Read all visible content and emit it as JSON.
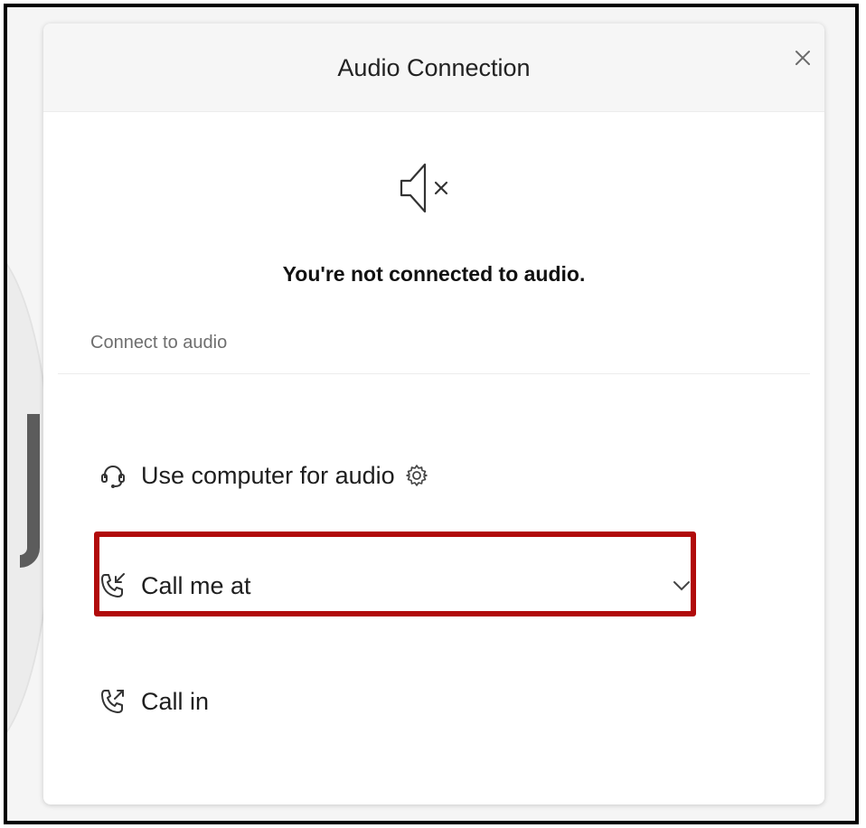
{
  "dialog": {
    "title": "Audio Connection",
    "close_glyph": "×"
  },
  "status": {
    "icon": "speaker-muted-icon",
    "message": "You're not connected to audio."
  },
  "connect_section": {
    "label": "Connect to audio",
    "options": [
      {
        "label": "Use computer for audio",
        "icon": "headset-icon",
        "settings_icon": "gear-icon"
      },
      {
        "label": "Call me at",
        "icon": "phone-incoming-icon",
        "dropdown_icon": "chevron-down-icon",
        "highlighted": true
      },
      {
        "label": "Call in",
        "icon": "phone-outgoing-icon"
      }
    ]
  },
  "colors": {
    "highlight": "#b10b0b",
    "text": "#1e1e1e",
    "muted_text": "#6e6e6e",
    "frame": "#000000"
  }
}
